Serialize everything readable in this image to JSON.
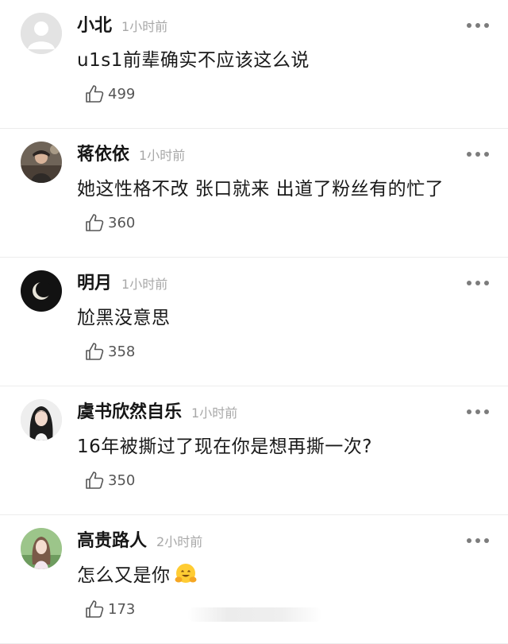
{
  "comments": [
    {
      "name": "小北",
      "time": "1小时前",
      "text": "u1s1前辈确实不应该这么说",
      "likes": "499",
      "avatar": "default-avatar"
    },
    {
      "name": "蒋依依",
      "time": "1小时前",
      "text": "她这性格不改 张口就来 出道了粉丝有的忙了",
      "likes": "360",
      "avatar": "photo-avatar"
    },
    {
      "name": "明月",
      "time": "1小时前",
      "text": "尬黑没意思",
      "likes": "358",
      "avatar": "moon-avatar"
    },
    {
      "name": "虞书欣然自乐",
      "time": "1小时前",
      "text": "16年被撕过了现在你是想再撕一次?",
      "likes": "350",
      "avatar": "girl-avatar"
    },
    {
      "name": "高贵路人",
      "time": "2小时前",
      "text": "怎么又是你",
      "likes": "173",
      "avatar": "girl-avatar-green",
      "emoji": "hugging-face-emoji"
    }
  ]
}
